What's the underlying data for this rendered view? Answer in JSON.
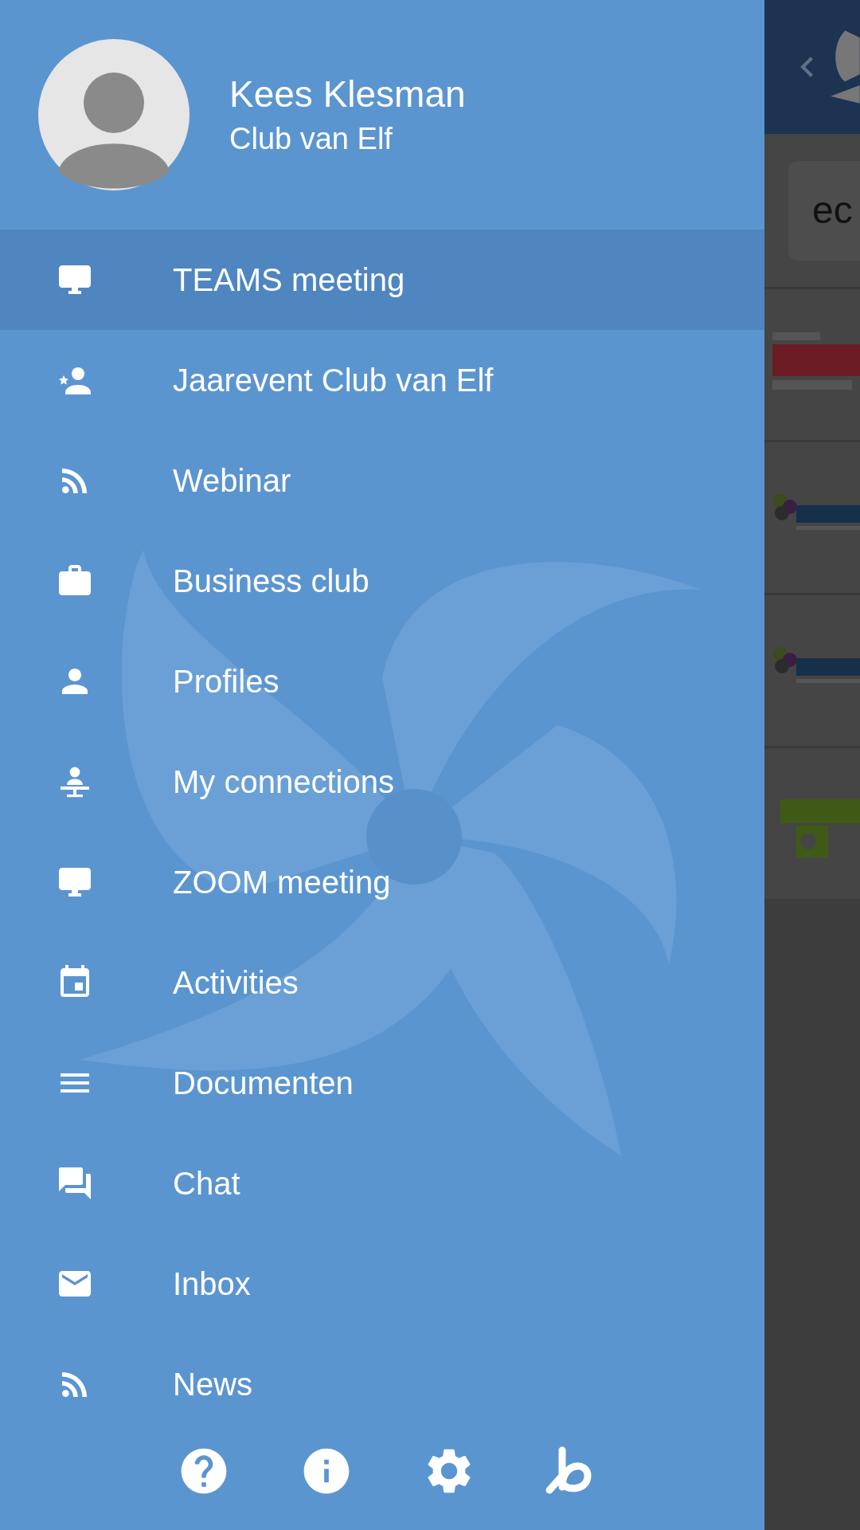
{
  "profile": {
    "name": "Kees Klesman",
    "organization": "Club van Elf"
  },
  "menu": [
    {
      "label": "TEAMS meeting",
      "selected": true
    },
    {
      "label": "Jaarevent Club van Elf",
      "selected": false
    },
    {
      "label": "Webinar",
      "selected": false
    },
    {
      "label": "Business club",
      "selected": false
    },
    {
      "label": "Profiles",
      "selected": false
    },
    {
      "label": "My connections",
      "selected": false
    },
    {
      "label": "ZOOM meeting",
      "selected": false
    },
    {
      "label": "Activities",
      "selected": false
    },
    {
      "label": "Documenten",
      "selected": false
    },
    {
      "label": "Chat",
      "selected": false
    },
    {
      "label": "Inbox",
      "selected": false
    },
    {
      "label": "News",
      "selected": false
    }
  ],
  "background_page": {
    "search": {
      "value": "ec"
    }
  }
}
